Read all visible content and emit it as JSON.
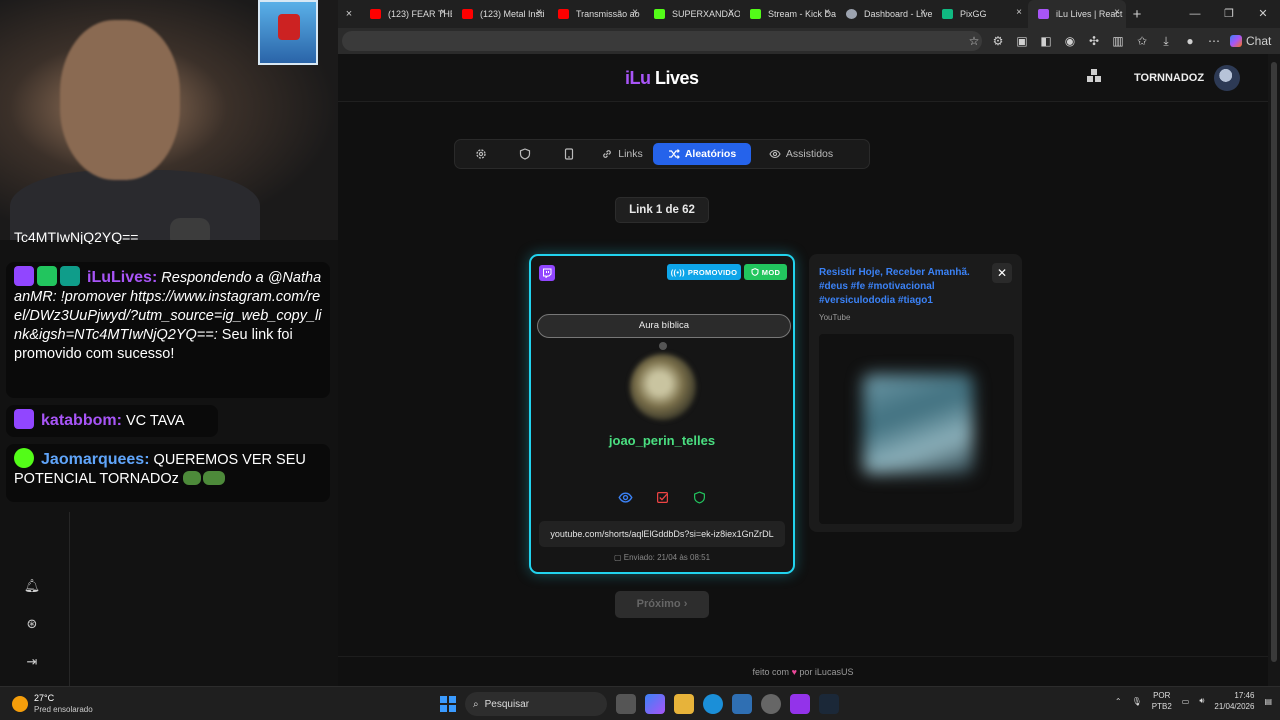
{
  "browser": {
    "tabs": [
      {
        "label": "(123) FEAR THE",
        "color": "#ff0000"
      },
      {
        "label": "(123) Metal Insti",
        "color": "#ff0000"
      },
      {
        "label": "Transmissão ao",
        "color": "#ff0000"
      },
      {
        "label": "SUPERXANDAO",
        "color": "#53fc18"
      },
      {
        "label": "Stream - Kick Da",
        "color": "#53fc18"
      },
      {
        "label": "Dashboard - Live",
        "color": "#9ca3af"
      },
      {
        "label": "PixGG",
        "color": "#10b981"
      },
      {
        "label": "iLu Lives | React",
        "color": "#a855f7"
      }
    ],
    "new_tab": "+",
    "close": "×",
    "chat_label": "Chat"
  },
  "app": {
    "logo_prefix": "iLu",
    "logo_suffix": " Lives",
    "username": "TORNNADOZ",
    "nav": {
      "links": "Links",
      "random": "Aleatórios",
      "watched": "Assistidos"
    },
    "counter": "Link 1 de 62",
    "main_card": {
      "badge_promo": "PROMOVIDO",
      "badge_mod": "MOD",
      "title": "Aura bíblica",
      "user": "joao_perin_telles",
      "url": "youtube.com/shorts/aqlElGddbDs?si=ek-iz8iex1GnZrDL",
      "sent": "Enviado: 21/04 às 08:51"
    },
    "side_card": {
      "title": "Resistir Hoje, Receber Amanhã. #deus #fe #motivacional #versiculododia #tiago1",
      "source": "YouTube",
      "close": "✕"
    },
    "next_button": "Próximo ›",
    "footer_before": "feito com",
    "footer_after": "por iLucasUS"
  },
  "overlay": {
    "cut_line": "Tc4MTIwNjQ2YQ==",
    "messages": [
      {
        "nick": "iLuLives:",
        "nick_color": "#a855f7",
        "italic": "Respondendo a @NathaanMR: !promover https://www.instagram.com/reel/DWz3UuPjwyd/?utm_source=ig_web_copy_link&igsh=NTc4MTIwNjQ2YQ==:",
        "text": " Seu link foi promovido com sucesso!"
      },
      {
        "nick": "katabbom:",
        "nick_color": "#a855f7",
        "text": " VC TAVA"
      },
      {
        "nick": "Jaomarquees:",
        "nick_color": "#60a5fa",
        "text": " QUEREMOS VER SEU POTENCIAL TORNADOz"
      }
    ]
  },
  "taskbar": {
    "temp": "27°C",
    "weather": "Pred ensolarado",
    "search": "Pesquisar",
    "lang1": "POR",
    "lang2": "PTB2",
    "time": "17:46",
    "date": "21/04/2026"
  }
}
